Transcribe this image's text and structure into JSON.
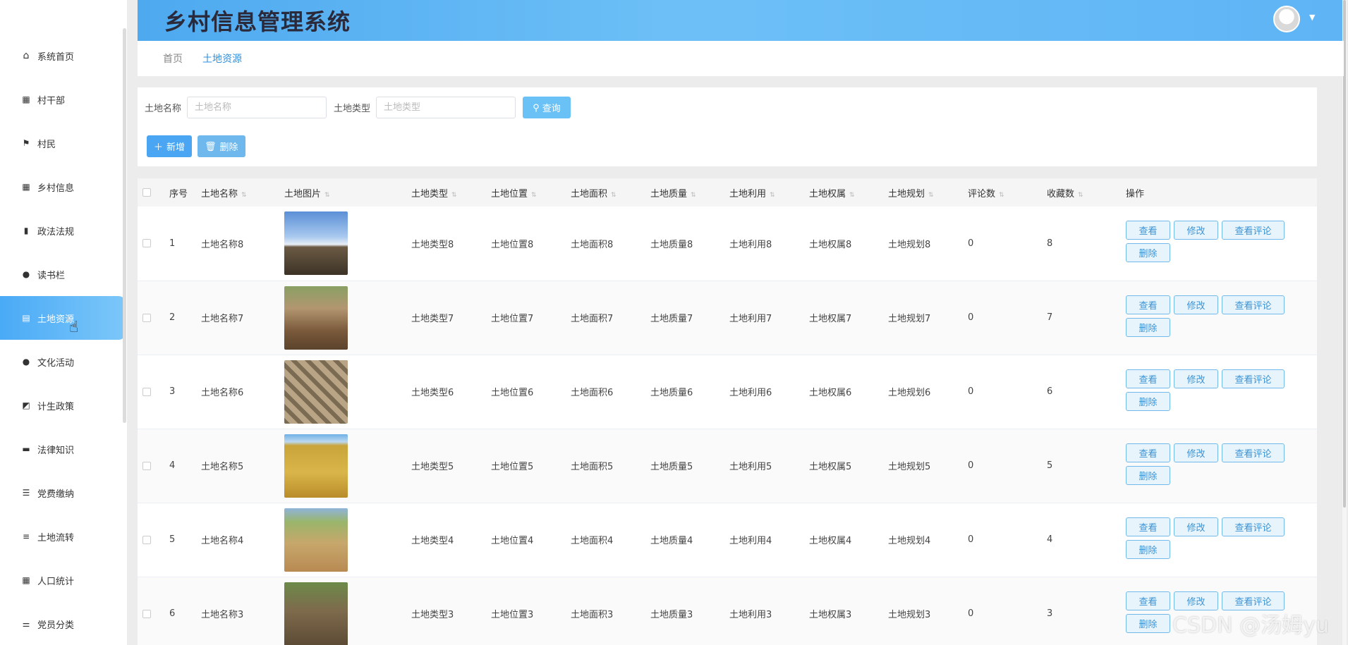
{
  "app": {
    "title": "乡村信息管理系统"
  },
  "sidebar": {
    "items": [
      {
        "label": "系统首页",
        "icon": "home-icon"
      },
      {
        "label": "村干部",
        "icon": "grid-icon"
      },
      {
        "label": "村民",
        "icon": "flag-icon"
      },
      {
        "label": "乡村信息",
        "icon": "grid-icon"
      },
      {
        "label": "政法法规",
        "icon": "bar-chart-icon"
      },
      {
        "label": "读书栏",
        "icon": "user-icon"
      },
      {
        "label": "土地资源",
        "icon": "clipboard-icon",
        "active": true
      },
      {
        "label": "文化活动",
        "icon": "location-pin-icon"
      },
      {
        "label": "计生政策",
        "icon": "line-chart-icon"
      },
      {
        "label": "法律知识",
        "icon": "briefcase-icon"
      },
      {
        "label": "党费缴纳",
        "icon": "list-icon"
      },
      {
        "label": "土地流转",
        "icon": "menu-icon"
      },
      {
        "label": "人口统计",
        "icon": "grid-icon"
      },
      {
        "label": "党员分类",
        "icon": "sliders-icon"
      }
    ]
  },
  "breadcrumb": {
    "home": "首页",
    "current": "土地资源"
  },
  "search": {
    "name_label": "土地名称",
    "name_placeholder": "土地名称",
    "type_label": "土地类型",
    "type_placeholder": "土地类型",
    "query_button": "查询"
  },
  "actions": {
    "add": "新增",
    "delete": "删除"
  },
  "table": {
    "headers": [
      "序号",
      "土地名称",
      "土地图片",
      "土地类型",
      "土地位置",
      "土地面积",
      "土地质量",
      "土地利用",
      "土地权属",
      "土地规划",
      "评论数",
      "收藏数",
      "操作"
    ],
    "ops": {
      "view": "查看",
      "edit": "修改",
      "comments": "查看评论",
      "delete": "删除"
    },
    "rows": [
      {
        "index": "1",
        "name": "土地名称8",
        "type": "土地类型8",
        "location": "土地位置8",
        "area": "土地面积8",
        "quality": "土地质量8",
        "use": "土地利用8",
        "ownership": "土地权属8",
        "plan": "土地规划8",
        "comments": "0",
        "favorites": "8"
      },
      {
        "index": "2",
        "name": "土地名称7",
        "type": "土地类型7",
        "location": "土地位置7",
        "area": "土地面积7",
        "quality": "土地质量7",
        "use": "土地利用7",
        "ownership": "土地权属7",
        "plan": "土地规划7",
        "comments": "0",
        "favorites": "7"
      },
      {
        "index": "3",
        "name": "土地名称6",
        "type": "土地类型6",
        "location": "土地位置6",
        "area": "土地面积6",
        "quality": "土地质量6",
        "use": "土地利用6",
        "ownership": "土地权属6",
        "plan": "土地规划6",
        "comments": "0",
        "favorites": "6"
      },
      {
        "index": "4",
        "name": "土地名称5",
        "type": "土地类型5",
        "location": "土地位置5",
        "area": "土地面积5",
        "quality": "土地质量5",
        "use": "土地利用5",
        "ownership": "土地权属5",
        "plan": "土地规划5",
        "comments": "0",
        "favorites": "5"
      },
      {
        "index": "5",
        "name": "土地名称4",
        "type": "土地类型4",
        "location": "土地位置4",
        "area": "土地面积4",
        "quality": "土地质量4",
        "use": "土地利用4",
        "ownership": "土地权属4",
        "plan": "土地规划4",
        "comments": "0",
        "favorites": "4"
      },
      {
        "index": "6",
        "name": "土地名称3",
        "type": "土地类型3",
        "location": "土地位置3",
        "area": "土地面积3",
        "quality": "土地质量3",
        "use": "土地利用3",
        "ownership": "土地权属3",
        "plan": "土地规划3",
        "comments": "0",
        "favorites": "3"
      }
    ]
  },
  "colors": {
    "accent": "#4aa6f2",
    "header": "#6dc0f7",
    "op_border": "#71b9ea"
  },
  "watermark": "CSDN @汤姆yu"
}
